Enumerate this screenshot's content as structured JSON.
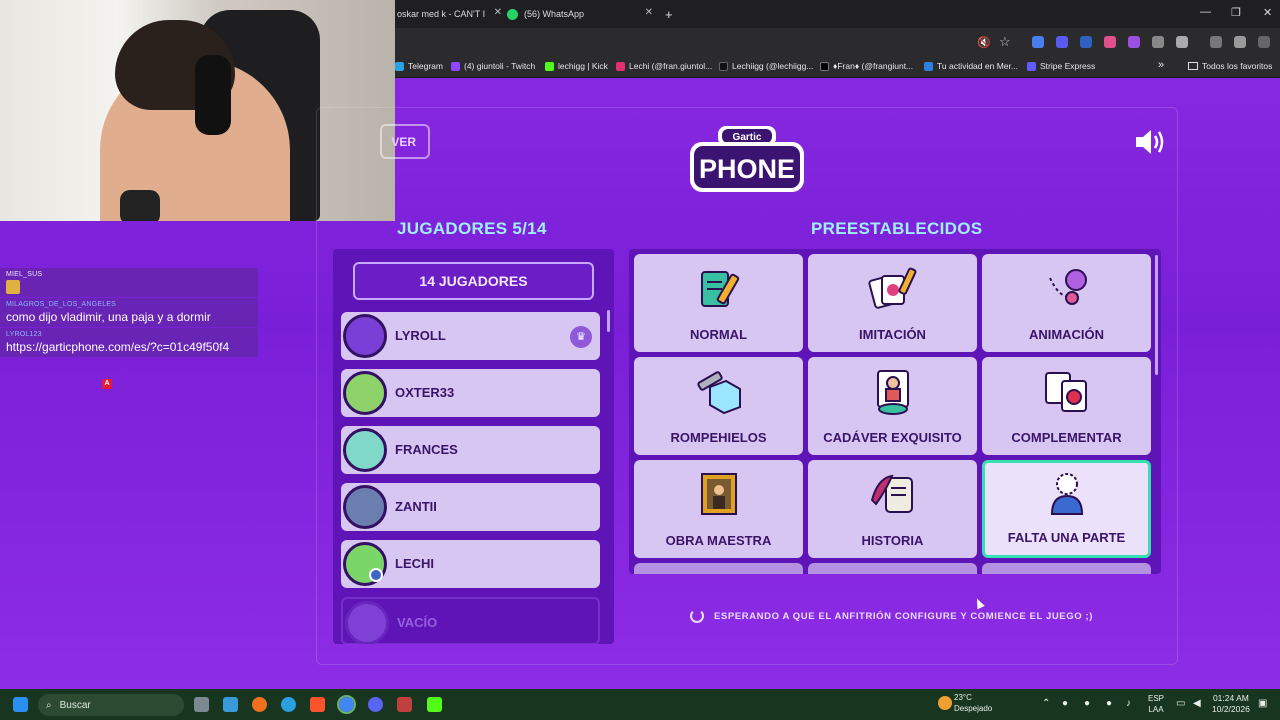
{
  "browser": {
    "tabs": [
      {
        "label": "oskar med k - CAN'T I"
      },
      {
        "label": "(56) WhatsApp"
      }
    ],
    "new_tab": "+",
    "tab_close": "✕",
    "bookmarks": [
      {
        "label": "Telegram",
        "color": "#2aa3e0"
      },
      {
        "label": "(4) giuntoli - Twitch",
        "color": "#9146ff"
      },
      {
        "label": "lechigg | Kick",
        "color": "#53fc18"
      },
      {
        "label": "Lechi (@fran.giuntol...",
        "color": "#e1306c"
      },
      {
        "label": "Lechiigg (@lechiigg...",
        "color": "#111111"
      },
      {
        "label": "♦Fran♦ (@frangiunt...",
        "color": "#000000"
      },
      {
        "label": "Tu actividad en Mer...",
        "color": "#2d7fe0"
      },
      {
        "label": "Stripe Express",
        "color": "#635bff"
      }
    ],
    "more_bookmarks": "»",
    "all_favorites": "Todos los favoritos"
  },
  "chat": [
    {
      "user": "MIEL_SUS",
      "message": "",
      "user_color": "#ece3ff"
    },
    {
      "user": "MILAGROS_DE_LOS_ANGELES",
      "message": "como dijo vladimir, una paja y a dormir",
      "user_color": "#8fb3ff"
    },
    {
      "user": "LYROL123",
      "message": "https://garticphone.com/es/?c=01c49f50f4",
      "user_color": "#8fb3ff"
    }
  ],
  "chat_badge": "A",
  "game": {
    "back_button": "VER",
    "logo_top": "Gartic",
    "logo_bottom": "PHONE",
    "players_heading": "JUGADORES 5/14",
    "presets_heading": "PREESTABLECIDOS",
    "player_count_button": "14 JUGADORES",
    "players": [
      {
        "name": "LYROLL",
        "color": "#7a3fd6",
        "host": true
      },
      {
        "name": "OXTER33",
        "color": "#8ed36a",
        "host": false
      },
      {
        "name": "FRANCES",
        "color": "#7fd8c8",
        "host": false
      },
      {
        "name": "ZANTII",
        "color": "#6a7fb0",
        "host": false
      },
      {
        "name": "LECHI",
        "color": "#7bd66a",
        "host": false,
        "leader": true
      },
      {
        "name": "VACÍO",
        "color": "#8a4fe0",
        "host": false,
        "empty": true
      }
    ],
    "presets": [
      {
        "label": "NORMAL",
        "icon": "pencil-paper-icon",
        "color": "#39c0a0"
      },
      {
        "label": "IMITACIÓN",
        "icon": "cards-icon",
        "color": "#e04080"
      },
      {
        "label": "ANIMACIÓN",
        "icon": "animation-pin-icon",
        "color": "#b060e0"
      },
      {
        "label": "ROMPEHIELOS",
        "icon": "ice-cube-icon",
        "color": "#6ad0f0"
      },
      {
        "label": "CADÁVER EXQUISITO",
        "icon": "body-puzzle-icon",
        "color": "#e05a5a"
      },
      {
        "label": "COMPLEMENTAR",
        "icon": "puzzle-apple-icon",
        "color": "#e03050"
      },
      {
        "label": "OBRA MAESTRA",
        "icon": "painting-icon",
        "color": "#e0a020"
      },
      {
        "label": "HISTORIA",
        "icon": "scroll-quill-icon",
        "color": "#c03070"
      },
      {
        "label": "FALTA UNA PARTE",
        "icon": "missing-part-icon",
        "color": "#3a6ad0",
        "selected": true
      }
    ],
    "waiting_text": "ESPERANDO A QUE EL ANFITRIÓN CONFIGURE Y COMIENCE EL JUEGO ;)"
  },
  "taskbar": {
    "search_placeholder": "Buscar",
    "weather_temp": "23°C",
    "weather_desc": "Despejado",
    "lang_top": "ESP",
    "lang_bottom": "LAA",
    "time": "01:24 AM",
    "date": "10/2/2026"
  }
}
